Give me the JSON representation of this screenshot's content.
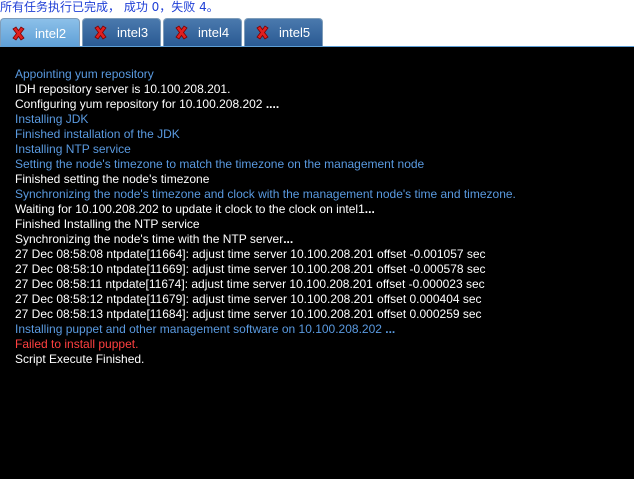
{
  "status_text": "所有任务执行已完成， 成功 0，失败 4。",
  "colors": {
    "info": "#5a9ae0",
    "normal": "#ffffff",
    "error": "#ff4040"
  },
  "tabs": [
    {
      "label": "intel2",
      "icon": "close-x-icon",
      "active": true
    },
    {
      "label": "intel3",
      "icon": "close-x-icon",
      "active": false
    },
    {
      "label": "intel4",
      "icon": "close-x-icon",
      "active": false
    },
    {
      "label": "intel5",
      "icon": "close-x-icon",
      "active": false
    }
  ],
  "log": [
    {
      "text": "Appointing yum repository",
      "kind": "info"
    },
    {
      "text": "IDH repository server is 10.100.208.201.",
      "kind": "normal"
    },
    {
      "text": "Configuring yum repository for 10.100.208.202 ",
      "suffix": "....",
      "kind": "normal"
    },
    {
      "text": "Installing JDK",
      "kind": "info"
    },
    {
      "text": "Finished installation of the JDK",
      "kind": "info"
    },
    {
      "text": "Installing NTP service",
      "kind": "info"
    },
    {
      "text": "Setting the node's timezone to match the timezone on the management node",
      "kind": "info"
    },
    {
      "text": "Finished setting the node's timezone",
      "kind": "normal"
    },
    {
      "text": "Synchronizing the node's timezone and clock with the management node's time and timezone.",
      "kind": "info"
    },
    {
      "text": "Waiting for 10.100.208.202 to update it clock to the clock on intel1",
      "suffix": "...",
      "kind": "normal"
    },
    {
      "text": "Finished Installing the NTP service",
      "kind": "normal"
    },
    {
      "text": "Synchronizing the node's time with the NTP server",
      "suffix": "...",
      "kind": "normal"
    },
    {
      "text": "27 Dec 08:58:08 ntpdate[11664]: adjust time server 10.100.208.201 offset -0.001057 sec",
      "kind": "normal"
    },
    {
      "text": "27 Dec 08:58:10 ntpdate[11669]: adjust time server 10.100.208.201 offset -0.000578 sec",
      "kind": "normal"
    },
    {
      "text": "27 Dec 08:58:11 ntpdate[11674]: adjust time server 10.100.208.201 offset -0.000023 sec",
      "kind": "normal"
    },
    {
      "text": "27 Dec 08:58:12 ntpdate[11679]: adjust time server 10.100.208.201 offset 0.000404 sec",
      "kind": "normal"
    },
    {
      "text": "27 Dec 08:58:13 ntpdate[11684]: adjust time server 10.100.208.201 offset 0.000259 sec",
      "kind": "normal"
    },
    {
      "text": "Installing puppet and other management software on 10.100.208.202 ",
      "suffix": "...",
      "kind": "info"
    },
    {
      "text": "Failed to install puppet.",
      "kind": "error"
    },
    {
      "text": "Script Execute Finished.",
      "kind": "normal"
    }
  ]
}
